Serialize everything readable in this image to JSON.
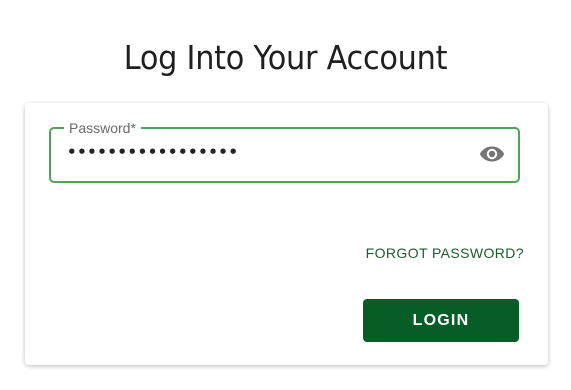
{
  "header": {
    "title": "Log Into Your Account"
  },
  "form": {
    "password": {
      "label": "Password*",
      "value": "•••••••••••••••••"
    },
    "forgot_label": "FORGOT PASSWORD?",
    "login_label": "LOGIN"
  },
  "icons": {
    "visibility": "eye-icon"
  },
  "colors": {
    "accent_border": "#4fa35a",
    "primary_button": "#065e26",
    "link": "#1e5c2c"
  }
}
